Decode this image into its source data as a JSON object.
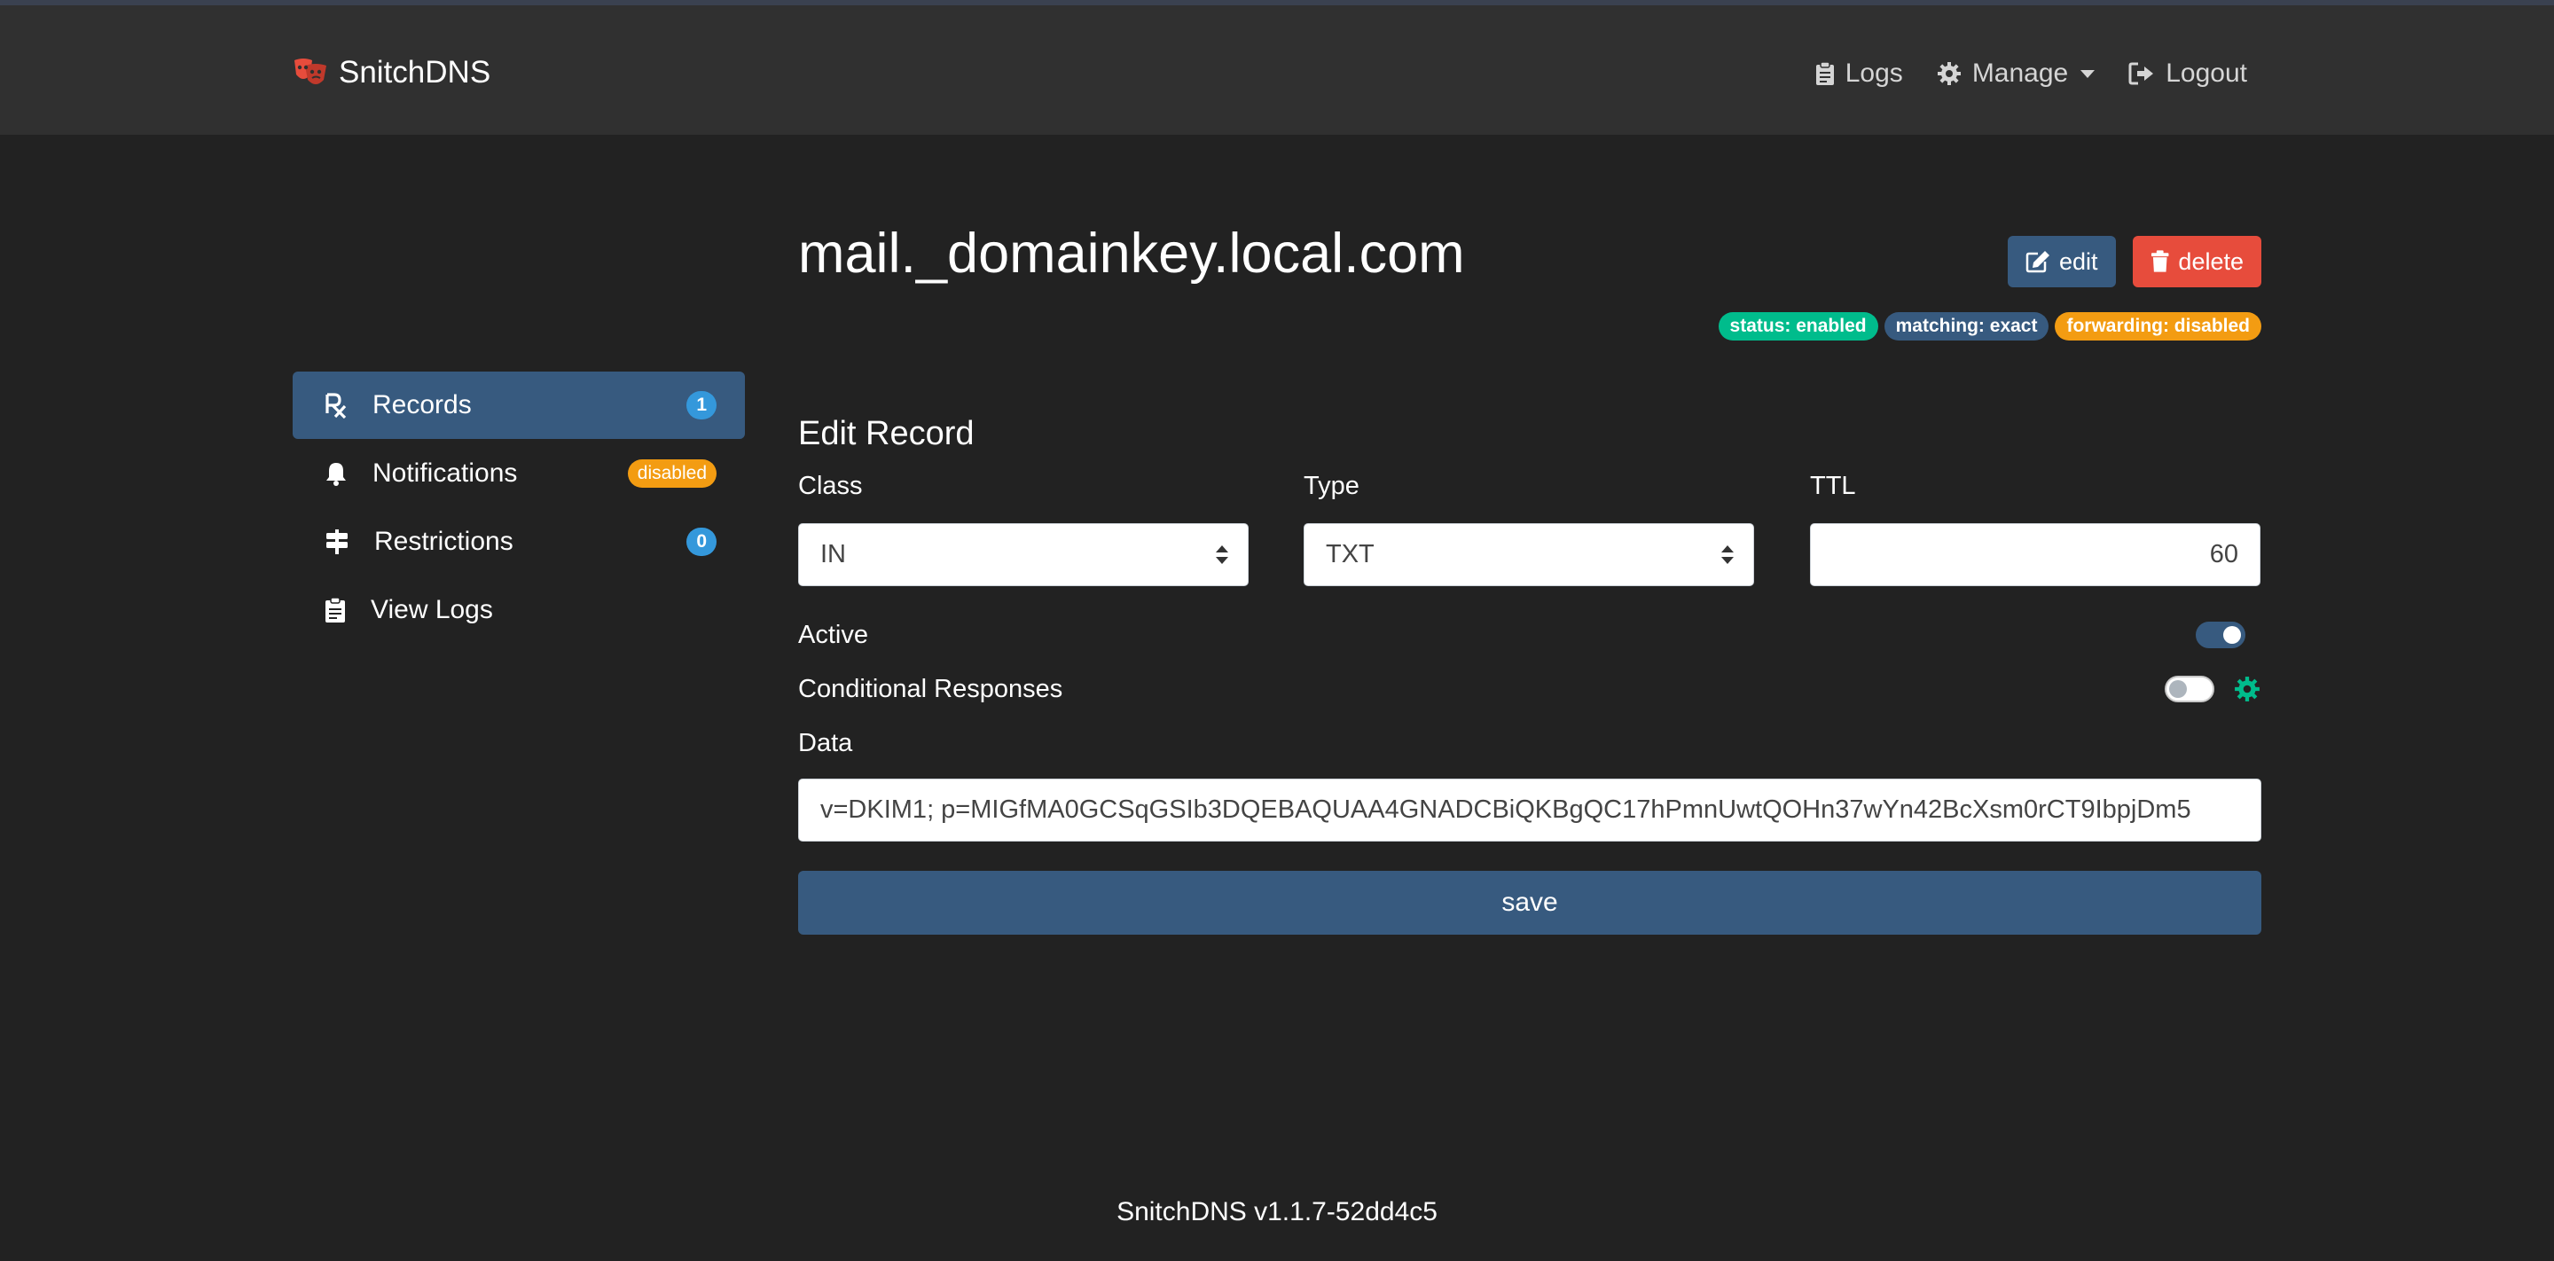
{
  "app": {
    "brand": "SnitchDNS",
    "brand_icon": "theater-masks-icon"
  },
  "nav": {
    "logs": "Logs",
    "manage": "Manage",
    "logout": "Logout"
  },
  "sidebar": {
    "items": [
      {
        "label": "Records",
        "icon": "prescription-icon",
        "badge": "1",
        "active": true
      },
      {
        "label": "Notifications",
        "icon": "bell-icon",
        "badge": "disabled"
      },
      {
        "label": "Restrictions",
        "icon": "signpost-icon",
        "badge": "0"
      },
      {
        "label": "View Logs",
        "icon": "clipboard-icon"
      }
    ]
  },
  "record": {
    "title": "mail._domainkey.local.com",
    "edit_label": "edit",
    "delete_label": "delete",
    "badges": {
      "status": "status: enabled",
      "matching": "matching: exact",
      "forwarding": "forwarding: disabled"
    }
  },
  "form": {
    "heading": "Edit Record",
    "class_label": "Class",
    "class_value": "IN",
    "type_label": "Type",
    "type_value": "TXT",
    "ttl_label": "TTL",
    "ttl_value": "60",
    "active_label": "Active",
    "active": true,
    "conditional_label": "Conditional Responses",
    "conditional": false,
    "data_label": "Data",
    "data_value": "v=DKIM1; p=MIGfMA0GCSqGSIb3DQEBAQUAA4GNADCBiQKBgQC17hPmnUwtQOHn37wYn42BcXsm0rCT9IbpjDm5",
    "save_label": "save"
  },
  "footer": {
    "version": "SnitchDNS v1.1.7-52dd4c5"
  },
  "colors": {
    "background": "#222222",
    "topbar": "#303030",
    "primary": "#375a7f",
    "danger": "#e74c3c",
    "success": "#00bc8c",
    "warning": "#f39c12",
    "info": "#3498db"
  }
}
